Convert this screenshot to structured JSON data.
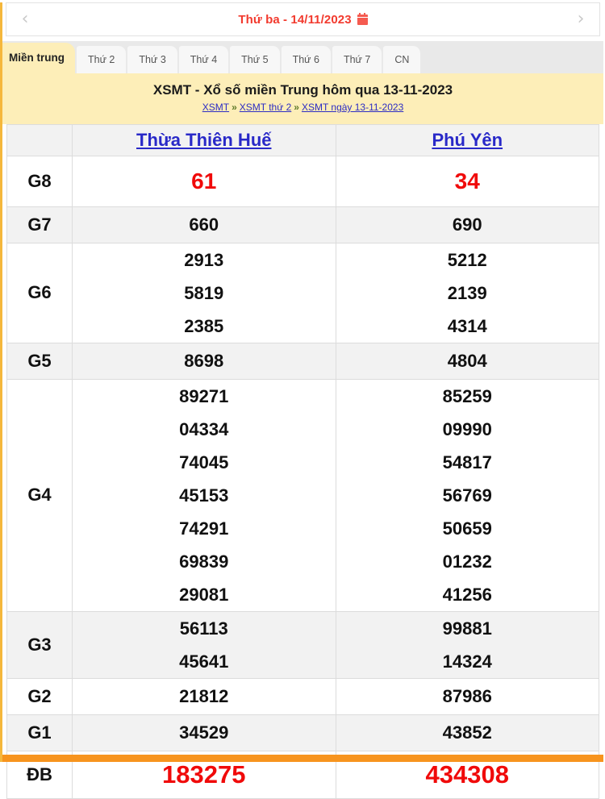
{
  "date_nav": {
    "prev_label": "‹",
    "next_label": "›",
    "date_text": "Thứ ba -  14/11/2023",
    "calendar_icon": "calendar-icon"
  },
  "tabs": [
    {
      "label": "Miền trung",
      "active": true
    },
    {
      "label": "Thứ 2",
      "active": false
    },
    {
      "label": "Thứ 3",
      "active": false
    },
    {
      "label": "Thứ 4",
      "active": false
    },
    {
      "label": "Thứ 5",
      "active": false
    },
    {
      "label": "Thứ 6",
      "active": false
    },
    {
      "label": "Thứ 7",
      "active": false
    },
    {
      "label": "CN",
      "active": false
    }
  ],
  "banner": {
    "title": "XSMT - Xổ số miền Trung hôm qua 13-11-2023",
    "breadcrumb": [
      "XSMT",
      "XSMT thứ 2",
      "XSMT ngày 13-11-2023"
    ],
    "breadcrumb_separator": "»"
  },
  "table": {
    "corner_label": "",
    "columns": [
      "Thừa Thiên Huế",
      "Phú Yên"
    ],
    "rows": [
      {
        "prize": "G8",
        "hue": [
          "61"
        ],
        "phuyen": [
          "34"
        ]
      },
      {
        "prize": "G7",
        "hue": [
          "660"
        ],
        "phuyen": [
          "690"
        ]
      },
      {
        "prize": "G6",
        "hue": [
          "2913",
          "5819",
          "2385"
        ],
        "phuyen": [
          "5212",
          "2139",
          "4314"
        ]
      },
      {
        "prize": "G5",
        "hue": [
          "8698"
        ],
        "phuyen": [
          "4804"
        ]
      },
      {
        "prize": "G4",
        "hue": [
          "89271",
          "04334",
          "74045",
          "45153",
          "74291",
          "69839",
          "29081"
        ],
        "phuyen": [
          "85259",
          "09990",
          "54817",
          "56769",
          "50659",
          "01232",
          "41256"
        ]
      },
      {
        "prize": "G3",
        "hue": [
          "56113",
          "45641"
        ],
        "phuyen": [
          "99881",
          "14324"
        ]
      },
      {
        "prize": "G2",
        "hue": [
          "21812"
        ],
        "phuyen": [
          "87986"
        ]
      },
      {
        "prize": "G1",
        "hue": [
          "34529"
        ],
        "phuyen": [
          "43852"
        ]
      },
      {
        "prize": "ĐB",
        "hue": [
          "183275"
        ],
        "phuyen": [
          "434308"
        ]
      }
    ]
  },
  "colors": {
    "accent_orange": "#f7941e",
    "banner_yellow": "#fdeeb8",
    "highlight_red": "#f00a0a",
    "date_red": "#f23a2e",
    "link_blue": "#2929c8",
    "row_shade": "#f2f2f2"
  }
}
